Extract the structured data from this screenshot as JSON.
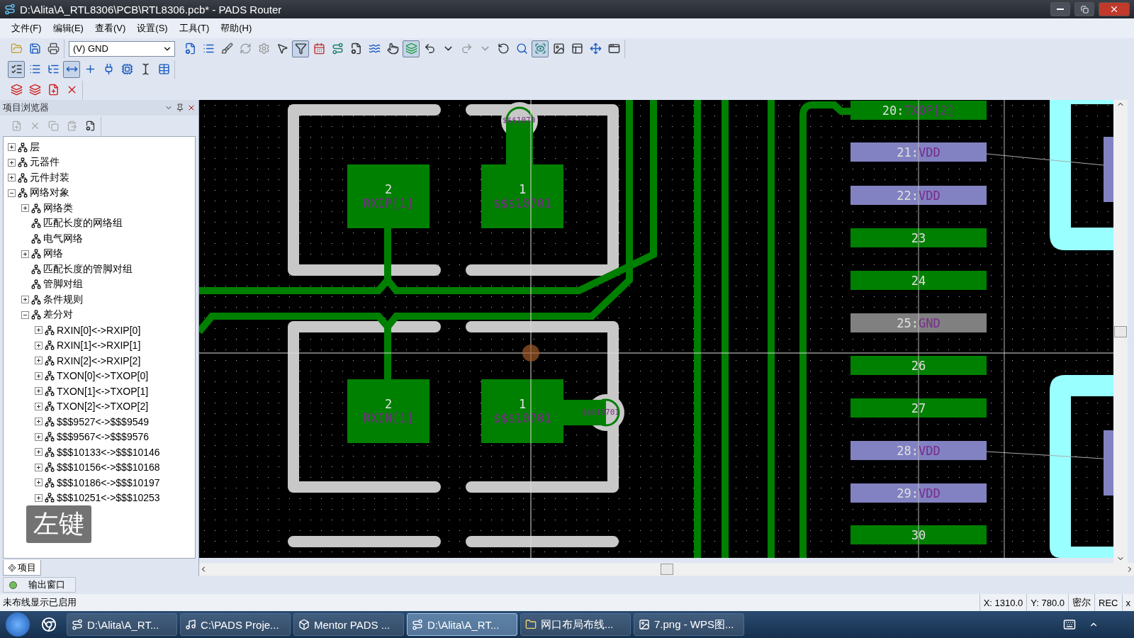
{
  "window": {
    "title": "D:\\Alita\\A_RTL8306\\PCB\\RTL8306.pcb* - PADS Router"
  },
  "menu": [
    "文件(F)",
    "编辑(E)",
    "查看(V)",
    "设置(S)",
    "工具(T)",
    "帮助(H)"
  ],
  "toolbar_1_left": [
    {
      "pressed": false
    },
    {
      "pressed": false
    },
    {
      "pressed": false
    }
  ],
  "net_filter": {
    "value": "(V) GND"
  },
  "toolbar_1_right": [
    {
      "pressed": false
    },
    {
      "pressed": false
    },
    {
      "pressed": false
    },
    {
      "pressed": false
    },
    {
      "pressed": false
    },
    {
      "pressed": false
    },
    {
      "pressed": true
    },
    {
      "pressed": false
    },
    {
      "pressed": false
    },
    {
      "pressed": false
    },
    {
      "pressed": false
    },
    {
      "pressed": false
    },
    {
      "pressed": true
    },
    {
      "pressed": false
    },
    {
      "pressed": false
    },
    {
      "pressed": false
    },
    {
      "pressed": false
    },
    {
      "pressed": false
    },
    {
      "pressed": false
    },
    {
      "pressed": true
    },
    {
      "pressed": false
    },
    {
      "pressed": false
    },
    {
      "pressed": false
    },
    {
      "pressed": false
    }
  ],
  "toolbar_2": [
    {
      "pressed": true
    },
    {
      "pressed": false
    },
    {
      "pressed": false
    },
    {
      "pressed": true
    },
    {
      "pressed": false
    },
    {
      "pressed": false
    },
    {
      "pressed": false
    },
    {
      "pressed": false
    },
    {
      "pressed": false
    }
  ],
  "toolbar_3": [
    {
      "pressed": false
    },
    {
      "pressed": false
    },
    {
      "pressed": false
    },
    {
      "pressed": false
    }
  ],
  "browser": {
    "title": "项目浏览器",
    "tree": [
      {
        "label": "层",
        "kind": "branch",
        "expanded": false
      },
      {
        "label": "元器件",
        "kind": "branch",
        "expanded": false
      },
      {
        "label": "元件封装",
        "kind": "branch",
        "expanded": false
      },
      {
        "label": "网络对象",
        "kind": "branch",
        "expanded": true,
        "children": [
          {
            "label": "网络类",
            "kind": "branch",
            "expanded": false
          },
          {
            "label": "匹配长度的网络组",
            "kind": "leaf"
          },
          {
            "label": "电气网络",
            "kind": "leaf"
          },
          {
            "label": "网络",
            "kind": "branch",
            "expanded": false
          },
          {
            "label": "匹配长度的管脚对组",
            "kind": "leaf"
          },
          {
            "label": "管脚对组",
            "kind": "leaf"
          },
          {
            "label": "条件规则",
            "kind": "branch",
            "expanded": false
          },
          {
            "label": "差分对",
            "kind": "branch",
            "expanded": true,
            "children": [
              {
                "label": "RXIN[0]<->RXIP[0]",
                "kind": "branch",
                "expanded": false
              },
              {
                "label": "RXIN[1]<->RXIP[1]",
                "kind": "branch",
                "expanded": false
              },
              {
                "label": "RXIN[2]<->RXIP[2]",
                "kind": "branch",
                "expanded": false
              },
              {
                "label": "TXON[0]<->TXOP[0]",
                "kind": "branch",
                "expanded": false
              },
              {
                "label": "TXON[1]<->TXOP[1]",
                "kind": "branch",
                "expanded": false
              },
              {
                "label": "TXON[2]<->TXOP[2]",
                "kind": "branch",
                "expanded": false
              },
              {
                "label": "$$$9527<->$$$9549",
                "kind": "branch",
                "expanded": false
              },
              {
                "label": "$$$9567<->$$$9576",
                "kind": "branch",
                "expanded": false
              },
              {
                "label": "$$$10133<->$$$10146",
                "kind": "branch",
                "expanded": false
              },
              {
                "label": "$$$10156<->$$$10168",
                "kind": "branch",
                "expanded": false
              },
              {
                "label": "$$$10186<->$$$10197",
                "kind": "branch",
                "expanded": false
              },
              {
                "label": "$$$10251<->$$$10253",
                "kind": "branch",
                "expanded": false
              }
            ]
          }
        ]
      }
    ],
    "tabs": [
      {
        "label": "项目",
        "selected": true
      }
    ]
  },
  "key_overlay": "左键",
  "board": {
    "component_pads": [
      {
        "pin": "2",
        "net": "RXIP[1]"
      },
      {
        "pin": "1",
        "net": "$$$10701"
      },
      {
        "pin": "2",
        "net": "RXIN[1]"
      },
      {
        "pin": "1",
        "net": "$$$10701"
      }
    ],
    "vias": [
      {
        "label": "$$$1070"
      },
      {
        "label": "$$$10701"
      }
    ],
    "ic_pads": [
      {
        "pin": "20:",
        "net": "TXOP[2]",
        "kind": "signal"
      },
      {
        "pin": "21:",
        "net": "VDD",
        "kind": "power"
      },
      {
        "pin": "22:",
        "net": "VDD",
        "kind": "power"
      },
      {
        "pin": "23",
        "kind": "signal"
      },
      {
        "pin": "24",
        "kind": "signal"
      },
      {
        "pin": "25:",
        "net": "GND",
        "kind": "ground"
      },
      {
        "pin": "26",
        "kind": "signal"
      },
      {
        "pin": "27",
        "kind": "signal"
      },
      {
        "pin": "28:",
        "net": "VDD",
        "kind": "power"
      },
      {
        "pin": "29:",
        "net": "VDD",
        "kind": "power"
      },
      {
        "pin": "30",
        "kind": "signal"
      }
    ]
  },
  "output_window": {
    "label": "输出窗口"
  },
  "status_bar": {
    "message": "未布线显示已启用",
    "x": "X: 1310.0",
    "y": "Y: 780.0",
    "units": "密尔",
    "rec": "REC",
    "close": "x"
  },
  "taskbar": [
    {
      "label": "D:\\Alita\\A_RT...",
      "selected": false
    },
    {
      "label": "C:\\PADS Proje...",
      "selected": false
    },
    {
      "label": "Mentor PADS ...",
      "selected": false
    },
    {
      "label": "D:\\Alita\\A_RT...",
      "selected": true
    },
    {
      "label": "网口布局布线...",
      "selected": false
    },
    {
      "label": "7.png - WPS图...",
      "selected": false
    }
  ]
}
